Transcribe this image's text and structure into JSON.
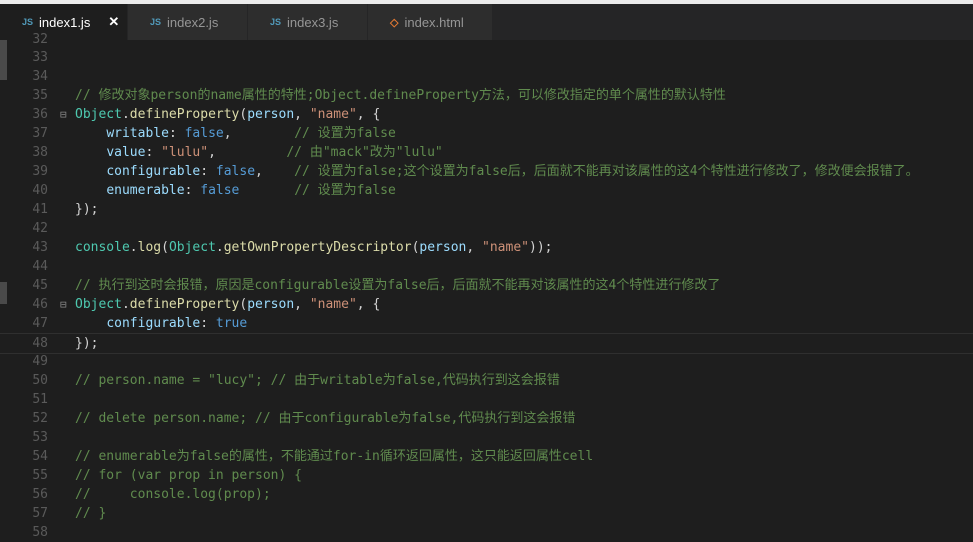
{
  "tabs": [
    {
      "label": "index1.js",
      "icon": "JS",
      "active": true,
      "close": "✕"
    },
    {
      "label": "index2.js",
      "icon": "JS"
    },
    {
      "label": "index3.js",
      "icon": "JS"
    },
    {
      "label": "index.html",
      "icon": "<>"
    }
  ],
  "lines": [
    {
      "n": "33",
      "tokens": []
    },
    {
      "n": "34",
      "tokens": []
    },
    {
      "n": "35",
      "tokens": [
        [
          "// 修改对象person的name属性的特性;Object.defineProperty方法，可以修改指定的单个属性的默认特性",
          "c"
        ]
      ]
    },
    {
      "n": "36",
      "fold": true,
      "tokens": [
        [
          "Object",
          "t"
        ],
        [
          ".",
          "p"
        ],
        [
          "defineProperty",
          "f"
        ],
        [
          "(",
          "p"
        ],
        [
          "person",
          "v"
        ],
        [
          ", ",
          "p"
        ],
        [
          "\"name\"",
          "s"
        ],
        [
          ", {",
          "p"
        ]
      ]
    },
    {
      "n": "37",
      "tokens": [
        [
          "    ",
          "p"
        ],
        [
          "writable",
          "v"
        ],
        [
          ": ",
          "p"
        ],
        [
          "false",
          "k"
        ],
        [
          ",        ",
          "p"
        ],
        [
          "// 设置为false",
          "c"
        ]
      ]
    },
    {
      "n": "38",
      "tokens": [
        [
          "    ",
          "p"
        ],
        [
          "value",
          "v"
        ],
        [
          ": ",
          "p"
        ],
        [
          "\"lulu\"",
          "s"
        ],
        [
          ",         ",
          "p"
        ],
        [
          "// 由\"mack\"改为\"lulu\"",
          "c"
        ]
      ]
    },
    {
      "n": "39",
      "tokens": [
        [
          "    ",
          "p"
        ],
        [
          "configurable",
          "v"
        ],
        [
          ": ",
          "p"
        ],
        [
          "false",
          "k"
        ],
        [
          ",    ",
          "p"
        ],
        [
          "// 设置为false;这个设置为false后，后面就不能再对该属性的这4个特性进行修改了，修改便会报错了。",
          "c"
        ]
      ]
    },
    {
      "n": "40",
      "tokens": [
        [
          "    ",
          "p"
        ],
        [
          "enumerable",
          "v"
        ],
        [
          ": ",
          "p"
        ],
        [
          "false",
          "k"
        ],
        [
          "       ",
          "p"
        ],
        [
          "// 设置为false",
          "c"
        ]
      ]
    },
    {
      "n": "41",
      "tokens": [
        [
          "});",
          "p"
        ]
      ]
    },
    {
      "n": "42",
      "tokens": []
    },
    {
      "n": "43",
      "tokens": [
        [
          "console",
          "t"
        ],
        [
          ".",
          "p"
        ],
        [
          "log",
          "f"
        ],
        [
          "(",
          "p"
        ],
        [
          "Object",
          "t"
        ],
        [
          ".",
          "p"
        ],
        [
          "getOwnPropertyDescriptor",
          "f"
        ],
        [
          "(",
          "p"
        ],
        [
          "person",
          "v"
        ],
        [
          ", ",
          "p"
        ],
        [
          "\"name\"",
          "s"
        ],
        [
          "));",
          "p"
        ]
      ]
    },
    {
      "n": "44",
      "tokens": []
    },
    {
      "n": "45",
      "tokens": [
        [
          "// 执行到这时会报错，原因是configurable设置为false后，后面就不能再对该属性的这4个特性进行修改了",
          "c"
        ]
      ]
    },
    {
      "n": "46",
      "fold": true,
      "tokens": [
        [
          "Object",
          "t"
        ],
        [
          ".",
          "p"
        ],
        [
          "defineProperty",
          "f"
        ],
        [
          "(",
          "p"
        ],
        [
          "person",
          "v"
        ],
        [
          ", ",
          "p"
        ],
        [
          "\"name\"",
          "s"
        ],
        [
          ", {",
          "p"
        ]
      ]
    },
    {
      "n": "47",
      "tokens": [
        [
          "    ",
          "p"
        ],
        [
          "configurable",
          "v"
        ],
        [
          ": ",
          "p"
        ],
        [
          "true",
          "k"
        ]
      ]
    },
    {
      "n": "48",
      "current": true,
      "tokens": [
        [
          "});",
          "p"
        ]
      ]
    },
    {
      "n": "49",
      "tokens": []
    },
    {
      "n": "50",
      "tokens": [
        [
          "// person.name = \"lucy\"; // 由于writable为false,代码执行到这会报错",
          "c"
        ]
      ]
    },
    {
      "n": "51",
      "tokens": []
    },
    {
      "n": "52",
      "tokens": [
        [
          "// delete person.name; // 由于configurable为false,代码执行到这会报错",
          "c"
        ]
      ]
    },
    {
      "n": "53",
      "tokens": []
    },
    {
      "n": "54",
      "tokens": [
        [
          "// enumerable为false的属性，不能通过for-in循环返回属性，这只能返回属性cell",
          "c"
        ]
      ]
    },
    {
      "n": "55",
      "tokens": [
        [
          "// for (var prop in person) {",
          "c"
        ]
      ]
    },
    {
      "n": "56",
      "tokens": [
        [
          "//     console.log(prop);",
          "c"
        ]
      ]
    },
    {
      "n": "57",
      "tokens": [
        [
          "// }",
          "c"
        ]
      ]
    },
    {
      "n": "58",
      "tokens": []
    }
  ]
}
